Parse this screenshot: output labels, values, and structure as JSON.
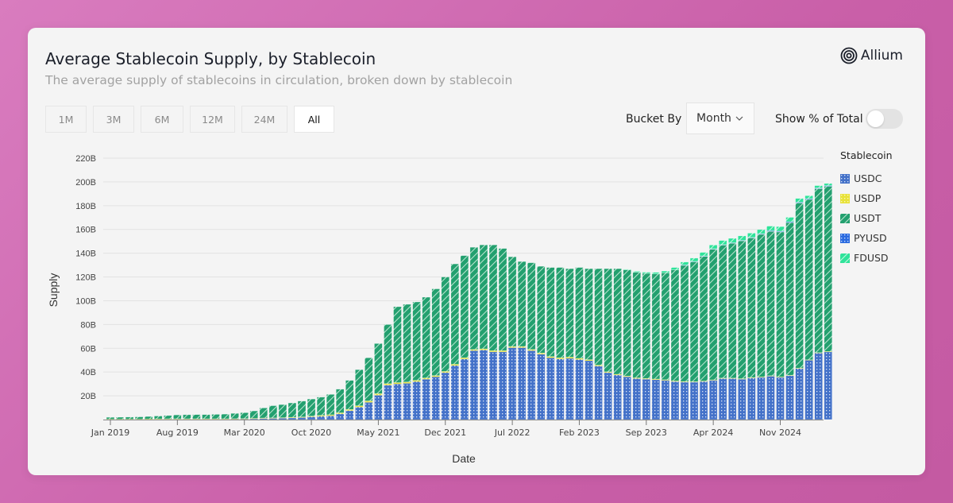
{
  "header": {
    "title": "Average Stablecoin Supply, by Stablecoin",
    "subtitle": "The average supply of stablecoins in circulation, broken down by stablecoin",
    "logo_text": "Allium",
    "logo_icon": "concentric-circles-icon"
  },
  "range_buttons": [
    {
      "label": "1M",
      "active": false
    },
    {
      "label": "3M",
      "active": false
    },
    {
      "label": "6M",
      "active": false
    },
    {
      "label": "12M",
      "active": false
    },
    {
      "label": "24M",
      "active": false
    },
    {
      "label": "All",
      "active": true
    }
  ],
  "controls": {
    "bucket_label": "Bucket By",
    "bucket_value": "Month",
    "bucket_icon": "chevron-down-icon",
    "pct_label": "Show % of Total",
    "pct_enabled": false
  },
  "chart_data": {
    "type": "bar",
    "stacked": true,
    "title": "Average Stablecoin Supply, by Stablecoin",
    "xlabel": "Date",
    "ylabel": "Supply",
    "ylim": [
      0,
      220
    ],
    "y_unit": "B",
    "y_ticks": [
      "20B",
      "40B",
      "60B",
      "80B",
      "100B",
      "120B",
      "140B",
      "160B",
      "180B",
      "200B",
      "220B"
    ],
    "x_tick_labels": [
      "Jan 2019",
      "Aug 2019",
      "Mar 2020",
      "Oct 2020",
      "May 2021",
      "Dec 2021",
      "Jul 2022",
      "Feb 2023",
      "Sep 2023",
      "Apr 2024",
      "Nov 2024"
    ],
    "x_tick_indices": [
      0,
      7,
      14,
      21,
      28,
      35,
      42,
      49,
      56,
      63,
      70
    ],
    "grid": true,
    "legend_title": "Stablecoin",
    "legend_position": "right",
    "start_month": "Jan 2019",
    "series": [
      {
        "name": "USDC",
        "color": "#4472c9",
        "pattern": "dots",
        "values": [
          0.2,
          0.2,
          0.2,
          0.2,
          0.3,
          0.3,
          0.4,
          0.4,
          0.4,
          0.4,
          0.4,
          0.4,
          0.4,
          0.5,
          0.6,
          0.7,
          0.9,
          1.0,
          1.2,
          1.4,
          1.7,
          2.3,
          2.8,
          3.2,
          4.8,
          7.5,
          10.5,
          14.5,
          20.5,
          29,
          30,
          30.5,
          32,
          34,
          36,
          39.5,
          45.5,
          51,
          58,
          58.5,
          57,
          57,
          60.5,
          60.5,
          58,
          55,
          52,
          51,
          51.5,
          50.5,
          49.5,
          45,
          39.5,
          37.5,
          36,
          34.5,
          34,
          33.5,
          33,
          32,
          31.5,
          31.5,
          32,
          33,
          34.5,
          34.5,
          34,
          35,
          35.5,
          36.5,
          35.5,
          37,
          43,
          50,
          56,
          57
        ]
      },
      {
        "name": "USDP",
        "color": "#e8e23a",
        "pattern": "dots",
        "values": [
          0.1,
          0.1,
          0.1,
          0.1,
          0.1,
          0.2,
          0.2,
          0.2,
          0.2,
          0.2,
          0.2,
          0.2,
          0.2,
          0.2,
          0.2,
          0.3,
          0.4,
          0.4,
          0.4,
          0.5,
          0.5,
          0.6,
          0.7,
          0.8,
          0.9,
          1.0,
          1.1,
          1.2,
          1.3,
          1.2,
          1.1,
          1.1,
          1.0,
          1.0,
          1.0,
          1.0,
          1.0,
          1.0,
          1.0,
          1.0,
          1.0,
          1.0,
          1.0,
          1.0,
          1.0,
          1.0,
          1.0,
          1.0,
          1.0,
          1.0,
          0.9,
          0.8,
          0.7,
          0.6,
          0.6,
          0.6,
          0.6,
          0.6,
          0.5,
          0.5,
          0.5,
          0.4,
          0.4,
          0.4,
          0.4,
          0.4,
          0.4,
          0.4,
          0.4,
          0.4,
          0.4,
          0.3,
          0.3,
          0.3,
          0.3,
          0.3
        ]
      },
      {
        "name": "USDT",
        "color": "#23a06f",
        "pattern": "hatch",
        "values": [
          1.6,
          1.7,
          1.8,
          2.0,
          2.2,
          2.5,
          2.8,
          3.3,
          3.5,
          3.6,
          3.6,
          3.8,
          4.0,
          4.5,
          5.0,
          6.3,
          8.5,
          10.3,
          11.0,
          12.1,
          13.4,
          14.4,
          15.4,
          17.2,
          19.9,
          24.5,
          30.4,
          36.3,
          42.2,
          49.8,
          63.9,
          65.4,
          66,
          68,
          73,
          79.5,
          84.5,
          86,
          86,
          87.5,
          89,
          86,
          75.5,
          71.5,
          73,
          73,
          75,
          76,
          74.5,
          76.5,
          76.6,
          81.2,
          86.8,
          88.9,
          89.4,
          88.9,
          88.4,
          88.5,
          90,
          93.5,
          98,
          101,
          105,
          110,
          112,
          113.5,
          116,
          117.5,
          120,
          121.5,
          122,
          128.5,
          139,
          135,
          138,
          139
        ]
      },
      {
        "name": "PYUSD",
        "color": "#2b6be0",
        "pattern": "dots",
        "values": [
          0,
          0,
          0,
          0,
          0,
          0,
          0,
          0,
          0,
          0,
          0,
          0,
          0,
          0,
          0,
          0,
          0,
          0,
          0,
          0,
          0,
          0,
          0,
          0,
          0,
          0,
          0,
          0,
          0,
          0,
          0,
          0,
          0,
          0,
          0,
          0,
          0,
          0,
          0,
          0,
          0,
          0,
          0,
          0,
          0,
          0,
          0,
          0,
          0,
          0,
          0,
          0,
          0,
          0,
          0,
          0,
          0,
          0,
          0,
          0,
          0.1,
          0.2,
          0.3,
          0.3,
          0.3,
          0.4,
          0.4,
          0.4,
          0.5,
          0.6,
          0.6,
          0.7,
          0.6,
          0.6,
          0.6,
          0.6
        ]
      },
      {
        "name": "FDUSD",
        "color": "#2fe39a",
        "pattern": "hatch",
        "values": [
          0,
          0,
          0,
          0,
          0,
          0,
          0,
          0,
          0,
          0,
          0,
          0,
          0,
          0,
          0,
          0,
          0,
          0,
          0,
          0,
          0,
          0,
          0,
          0,
          0,
          0,
          0,
          0,
          0,
          0,
          0,
          0,
          0,
          0,
          0,
          0,
          0,
          0,
          0,
          0,
          0,
          0,
          0,
          0,
          0,
          0,
          0,
          0,
          0,
          0,
          0,
          0,
          0,
          0,
          0.5,
          0.8,
          1.0,
          1.3,
          1.5,
          2.0,
          2.5,
          2.8,
          3.0,
          3.2,
          3.5,
          3.7,
          3.8,
          3.6,
          3.5,
          3.8,
          3.9,
          3.7,
          3.2,
          2.5,
          2.0,
          1.8
        ]
      }
    ]
  }
}
